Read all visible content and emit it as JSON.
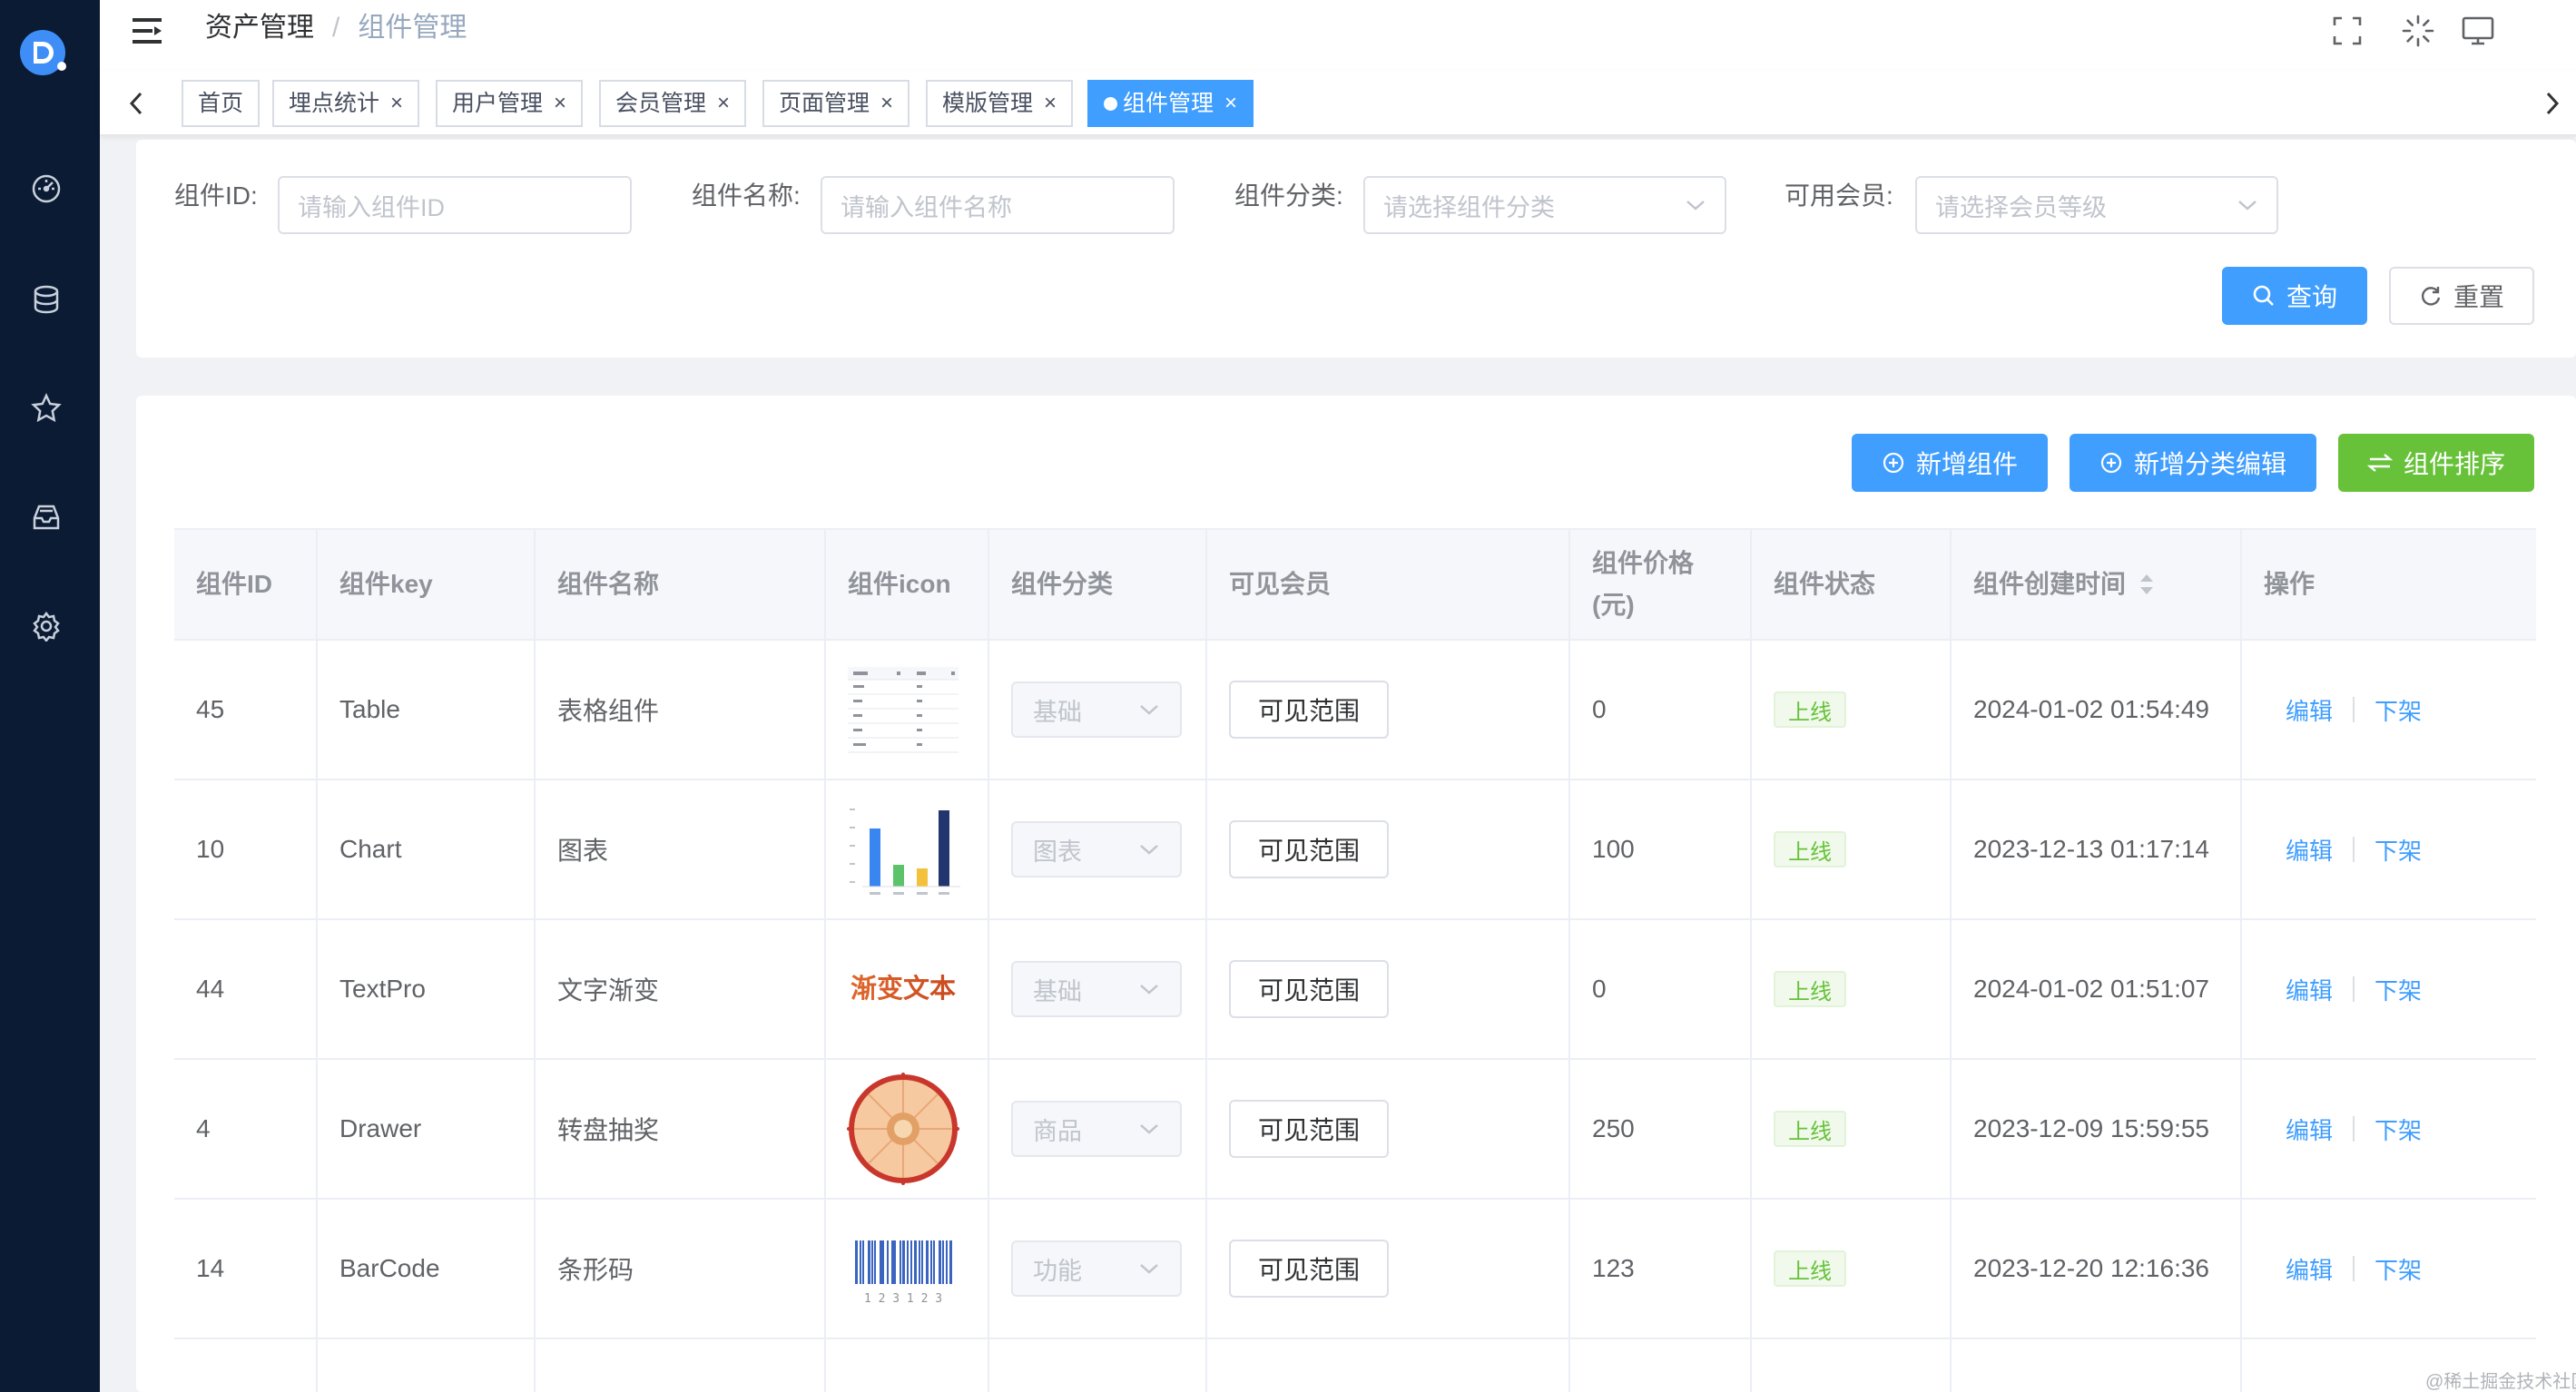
{
  "colors": {
    "primary": "#409eff",
    "success": "#67c23a",
    "sidebar": "#0a1b33"
  },
  "sidebar": {
    "logo": "app-logo",
    "items": [
      {
        "icon": "dashboard-icon"
      },
      {
        "icon": "database-icon"
      },
      {
        "icon": "star-icon"
      },
      {
        "icon": "inbox-icon"
      },
      {
        "icon": "gear-icon"
      }
    ]
  },
  "header": {
    "breadcrumb": [
      "资产管理",
      "组件管理"
    ],
    "breadcrumb_sep": "/",
    "icons": [
      "fullscreen-icon",
      "loading-spinner-icon",
      "monitor-icon"
    ]
  },
  "tabs": [
    {
      "label": "首页",
      "closable": false
    },
    {
      "label": "埋点统计",
      "closable": true
    },
    {
      "label": "用户管理",
      "closable": true
    },
    {
      "label": "会员管理",
      "closable": true
    },
    {
      "label": "页面管理",
      "closable": true
    },
    {
      "label": "模版管理",
      "closable": true
    },
    {
      "label": "组件管理",
      "closable": true,
      "active": true
    }
  ],
  "tab_close_glyph": "×",
  "search": {
    "id_label": "组件ID:",
    "id_placeholder": "请输入组件ID",
    "name_label": "组件名称:",
    "name_placeholder": "请输入组件名称",
    "category_label": "组件分类:",
    "category_placeholder": "请选择组件分类",
    "member_label": "可用会员:",
    "member_placeholder": "请选择会员等级",
    "query_label": "查询",
    "reset_label": "重置"
  },
  "toolbar": {
    "add_label": "新增组件",
    "add_category_label": "新增分类编辑",
    "sort_label": "组件排序"
  },
  "table": {
    "headers": {
      "id": "组件ID",
      "key": "组件key",
      "name": "组件名称",
      "icon": "组件icon",
      "category": "组件分类",
      "members": "可见会员",
      "price_line1": "组件价格",
      "price_line2": "(元)",
      "status": "组件状态",
      "created": "组件创建时间",
      "ops": "操作"
    },
    "rows": [
      {
        "id": "45",
        "key": "Table",
        "name": "表格组件",
        "icon": "table-thumbnail",
        "category": "基础",
        "visible": "可见范围",
        "price": "0",
        "status": "上线",
        "created": "2024-01-02 01:54:49",
        "edit": "编辑",
        "offline": "下架"
      },
      {
        "id": "10",
        "key": "Chart",
        "name": "图表",
        "icon": "bar-chart-thumbnail",
        "category": "图表",
        "visible": "可见范围",
        "price": "100",
        "status": "上线",
        "created": "2023-12-13 01:17:14",
        "edit": "编辑",
        "offline": "下架"
      },
      {
        "id": "44",
        "key": "TextPro",
        "name": "文字渐变",
        "icon": "gradient-text-thumbnail",
        "icon_text": "渐变文本",
        "category": "基础",
        "visible": "可见范围",
        "price": "0",
        "status": "上线",
        "created": "2024-01-02 01:51:07",
        "edit": "编辑",
        "offline": "下架"
      },
      {
        "id": "4",
        "key": "Drawer",
        "name": "转盘抽奖",
        "icon": "prize-wheel-thumbnail",
        "category": "商品",
        "visible": "可见范围",
        "price": "250",
        "status": "上线",
        "created": "2023-12-09 15:59:55",
        "edit": "编辑",
        "offline": "下架"
      },
      {
        "id": "14",
        "key": "BarCode",
        "name": "条形码",
        "icon": "barcode-thumbnail",
        "icon_text": "1 2 3 1 2 3",
        "category": "功能",
        "visible": "可见范围",
        "price": "123",
        "status": "上线",
        "created": "2023-12-20 12:16:36",
        "edit": "编辑",
        "offline": "下架"
      }
    ]
  },
  "watermark": "@稀土掘金技术社区"
}
